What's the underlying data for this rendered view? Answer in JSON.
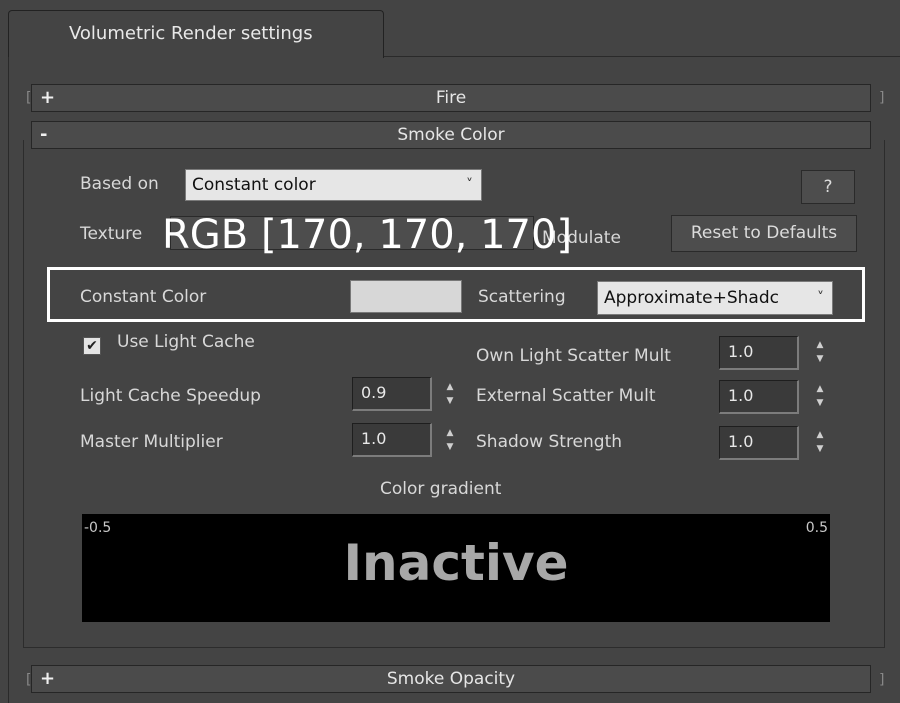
{
  "tab": {
    "label": "Volumetric Render settings"
  },
  "rollouts": {
    "fire": {
      "sign": "+",
      "label": "Fire"
    },
    "smoke_color": {
      "sign": "-",
      "label": "Smoke Color"
    },
    "smoke_opacity": {
      "sign": "+",
      "label": "Smoke Opacity"
    }
  },
  "smoke_color": {
    "based_on_label": "Based on",
    "based_on_value": "Constant color",
    "help_label": "?",
    "texture_label": "Texture",
    "modulate_label": "Modulate",
    "reset_label": "Reset to Defaults",
    "constant_color_label": "Constant Color",
    "constant_color_hex": "#d7d7d7",
    "scattering_label": "Scattering",
    "scattering_value": "Approximate+Shadc",
    "use_light_cache_label": "Use Light Cache",
    "use_light_cache_checked": true,
    "light_cache_speedup_label": "Light Cache Speedup",
    "light_cache_speedup_value": "0.9",
    "master_multiplier_label": "Master Multiplier",
    "master_multiplier_value": "1.0",
    "own_light_scatter_label": "Own Light Scatter Mult",
    "own_light_scatter_value": "1.0",
    "external_scatter_label": "External Scatter Mult",
    "external_scatter_value": "1.0",
    "shadow_strength_label": "Shadow Strength",
    "shadow_strength_value": "1.0",
    "color_gradient_label": "Color gradient",
    "gradient_min": "-0.5",
    "gradient_max": "0.5",
    "gradient_status": "Inactive"
  },
  "annotation": {
    "rgb_text": "RGB [170, 170, 170]"
  },
  "icons": {
    "dropdown_chevron": "˅",
    "spinner_up": "▲",
    "spinner_down": "▼",
    "checkmark": "✔"
  },
  "colors": {
    "panel_bg": "#444444",
    "highlight_outline": "#ffffff",
    "gradient_bg": "#000000"
  }
}
